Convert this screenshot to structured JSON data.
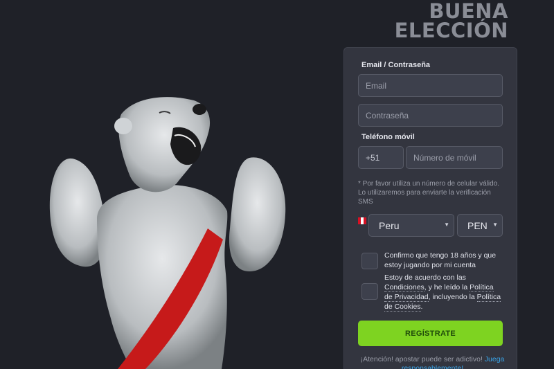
{
  "hero": {
    "line1": "BUENA",
    "line2": "ELECCIÓN"
  },
  "form": {
    "email_password_label": "Email / Contraseña",
    "email_placeholder": "Email",
    "password_placeholder": "Contraseña",
    "phone_label": "Teléfono móvil",
    "phone_prefix": "+51",
    "phone_placeholder": "Número de móvil",
    "phone_note": "* Por favor utiliza un número de celular válido. Lo utilizaremos para enviarte la verificación SMS",
    "country_value": "Peru",
    "currency_value": "PEN",
    "age_confirm": "Confirmo que tengo 18 años y que estoy jugando por mi cuenta",
    "terms_prefix": "Estoy de acuerdo con las ",
    "terms_link": "Condiciones",
    "terms_mid": ", y he leído la ",
    "privacy_link": "Política de Privacidad",
    "terms_mid2": ", incluyendo la ",
    "cookies_link": "Política de Cookies",
    "terms_end": ".",
    "register_label": "REGÍSTRATE",
    "warning_text": "¡Atención! apostar puede ser adictivo! ",
    "warning_link": "Juega responsablemente!"
  },
  "colors": {
    "background": "#1f2128",
    "panel": "#33353f",
    "accent_green": "#7ed321",
    "link_blue": "#39a4e8",
    "flag_red": "#d91023"
  },
  "icons": {
    "flag": "peru-flag-icon",
    "caret": "caret-down-icon"
  }
}
